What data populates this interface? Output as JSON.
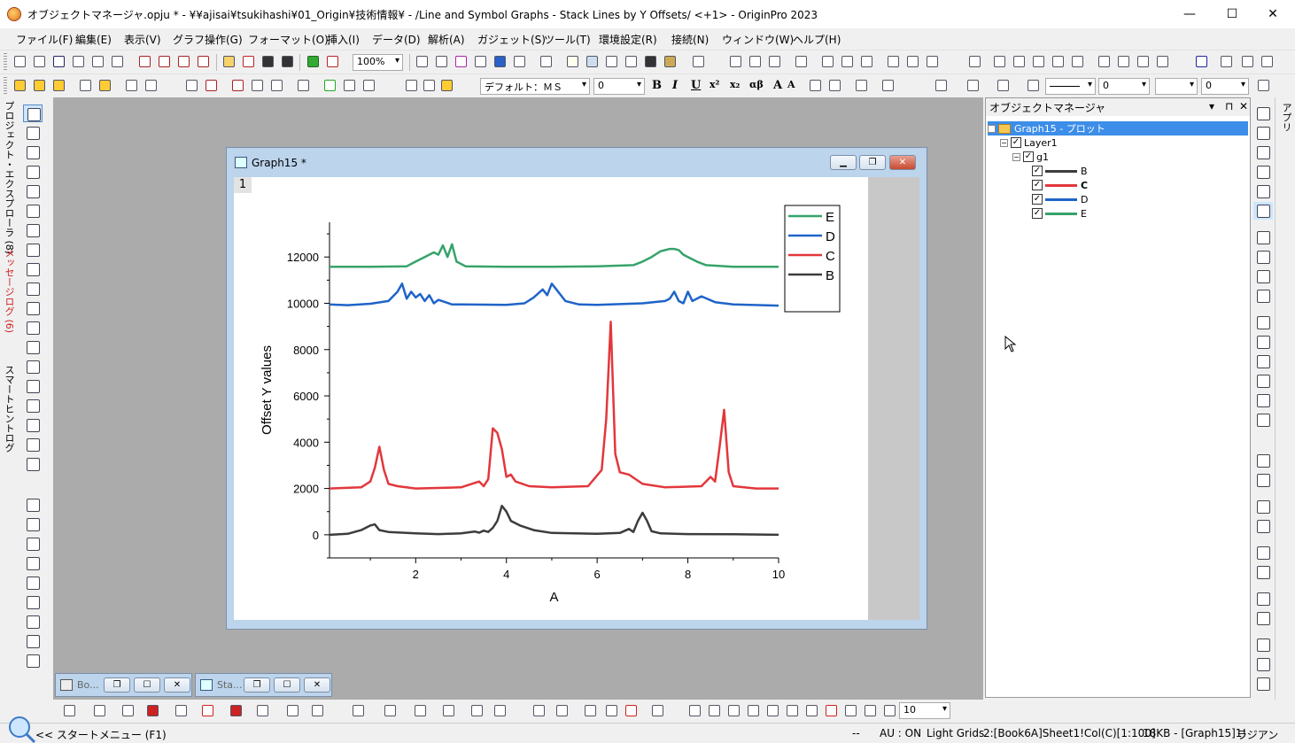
{
  "window": {
    "title": "オブジェクトマネージャ.opju * - ¥¥ajisai¥tsukihashi¥01_Origin¥技術情報¥ - /Line and Symbol Graphs - Stack Lines by Y Offsets/ <+1> - OriginPro 2023",
    "minimize": "—",
    "maximize": "☐",
    "close": "✕"
  },
  "menu": [
    "ファイル(F)",
    "編集(E)",
    "表示(V)",
    "グラフ操作(G)",
    "フォーマット(O)",
    "挿入(I)",
    "データ(D)",
    "解析(A)",
    "ガジェット(S)",
    "ツール(T)",
    "環境設定(R)",
    "接続(N)",
    "ウィンドウ(W)",
    "ヘルプ(H)"
  ],
  "toolbar": {
    "zoom": "100%",
    "font": "デフォルト：ＭＳ",
    "font_size": "0",
    "bold": "B",
    "italic": "I",
    "underline": "U",
    "sup": "x²",
    "sub": "x₂",
    "greek": "αβ",
    "grow": "A",
    "shrink": "A",
    "line_width": "0",
    "fill_value": "0",
    "bottom_zoom": "10"
  },
  "left_tabs": {
    "project": "プロジェクト・エクスプローラ (8)",
    "messages": "メッセージログ (6)",
    "smart": "スマートヒントログ"
  },
  "graph_window": {
    "title": "Graph15 *",
    "layer": "1"
  },
  "chart_data": {
    "type": "line",
    "xlabel": "A",
    "ylabel": "Offset Y values",
    "xlim": [
      0.1,
      10
    ],
    "ylim": [
      -1000,
      13500
    ],
    "xticks": [
      2,
      4,
      6,
      8,
      10
    ],
    "yticks": [
      0,
      2000,
      4000,
      6000,
      8000,
      10000,
      12000
    ],
    "legend_position": "top-right",
    "legend": [
      "E",
      "D",
      "C",
      "B"
    ],
    "series": [
      {
        "name": "B",
        "color": "#3c3c3c",
        "x": [
          0.1,
          0.5,
          0.8,
          1.0,
          1.1,
          1.2,
          1.4,
          2.0,
          2.5,
          3.0,
          3.3,
          3.4,
          3.5,
          3.6,
          3.7,
          3.8,
          3.9,
          4.0,
          4.1,
          4.3,
          4.6,
          5.0,
          6.0,
          6.5,
          6.7,
          6.8,
          6.9,
          7.0,
          7.1,
          7.2,
          7.4,
          8.0,
          9.0,
          10.0
        ],
        "y": [
          0,
          40,
          200,
          400,
          450,
          200,
          120,
          60,
          30,
          60,
          140,
          90,
          180,
          120,
          300,
          600,
          1250,
          1000,
          600,
          400,
          200,
          80,
          40,
          80,
          250,
          120,
          600,
          950,
          600,
          150,
          60,
          30,
          20,
          0
        ]
      },
      {
        "name": "C",
        "color": "#e2373c",
        "x": [
          0.1,
          0.8,
          1.0,
          1.1,
          1.2,
          1.3,
          1.4,
          1.6,
          2.0,
          3.0,
          3.4,
          3.5,
          3.6,
          3.7,
          3.8,
          3.9,
          4.0,
          4.1,
          4.2,
          4.5,
          5.0,
          5.8,
          6.1,
          6.2,
          6.3,
          6.4,
          6.5,
          6.7,
          7.0,
          7.5,
          8.3,
          8.5,
          8.6,
          8.7,
          8.8,
          8.9,
          9.0,
          9.5,
          10.0
        ],
        "y": [
          2000,
          2050,
          2300,
          2900,
          3800,
          2800,
          2200,
          2100,
          2000,
          2050,
          2300,
          2100,
          2400,
          4600,
          4400,
          3700,
          2500,
          2600,
          2300,
          2100,
          2050,
          2100,
          2800,
          5000,
          9200,
          3500,
          2700,
          2600,
          2200,
          2050,
          2100,
          2500,
          2300,
          3800,
          5400,
          2700,
          2100,
          2000,
          2000
        ]
      },
      {
        "name": "D",
        "color": "#1f64c8",
        "x": [
          0.1,
          0.5,
          1.0,
          1.4,
          1.6,
          1.7,
          1.8,
          1.9,
          2.0,
          2.1,
          2.2,
          2.3,
          2.4,
          2.5,
          2.8,
          3.0,
          4.0,
          4.4,
          4.6,
          4.8,
          4.9,
          5.0,
          5.1,
          5.3,
          5.6,
          6.0,
          7.0,
          7.5,
          7.6,
          7.7,
          7.8,
          7.9,
          8.0,
          8.1,
          8.3,
          8.6,
          9.0,
          10.0
        ],
        "y": [
          9950,
          9920,
          9980,
          10100,
          10500,
          10850,
          10200,
          10500,
          10250,
          10400,
          10100,
          10350,
          10000,
          10150,
          9950,
          9950,
          9930,
          10000,
          10250,
          10600,
          10350,
          10850,
          10600,
          10100,
          9950,
          9930,
          10000,
          10100,
          10200,
          10500,
          10100,
          10000,
          10500,
          10100,
          10300,
          10050,
          9950,
          9900
        ]
      },
      {
        "name": "E",
        "color": "#37a36b",
        "x": [
          0.1,
          1.0,
          1.8,
          2.0,
          2.2,
          2.4,
          2.5,
          2.6,
          2.7,
          2.8,
          2.9,
          3.1,
          4.0,
          5.0,
          6.0,
          6.8,
          7.0,
          7.2,
          7.4,
          7.5,
          7.6,
          7.7,
          7.8,
          7.9,
          8.0,
          8.2,
          8.4,
          9.0,
          10.0
        ],
        "y": [
          11580,
          11580,
          11600,
          11800,
          12000,
          12200,
          12100,
          12500,
          12000,
          12550,
          11800,
          11600,
          11580,
          11580,
          11600,
          11650,
          11800,
          12000,
          12250,
          12300,
          12350,
          12350,
          12300,
          12100,
          12000,
          11800,
          11650,
          11580,
          11580
        ]
      }
    ]
  },
  "object_manager": {
    "title": "オブジェクトマネージャ",
    "root": "Graph15 - プロット",
    "layer": "Layer1",
    "group": "g1",
    "items": [
      "B",
      "C",
      "D",
      "E"
    ]
  },
  "apps_label": "アプリ",
  "minimized": [
    "Bo...",
    "Sta..."
  ],
  "status": {
    "start": "<< スタートメニュー (F1)",
    "dash": "--",
    "au": "AU : ON",
    "grids": "Light Grids",
    "cell": "2:[Book6A]Sheet1!Col(C)[1:100]",
    "size": "18KB - [Graph15]1!",
    "unit": "ラジアン"
  }
}
